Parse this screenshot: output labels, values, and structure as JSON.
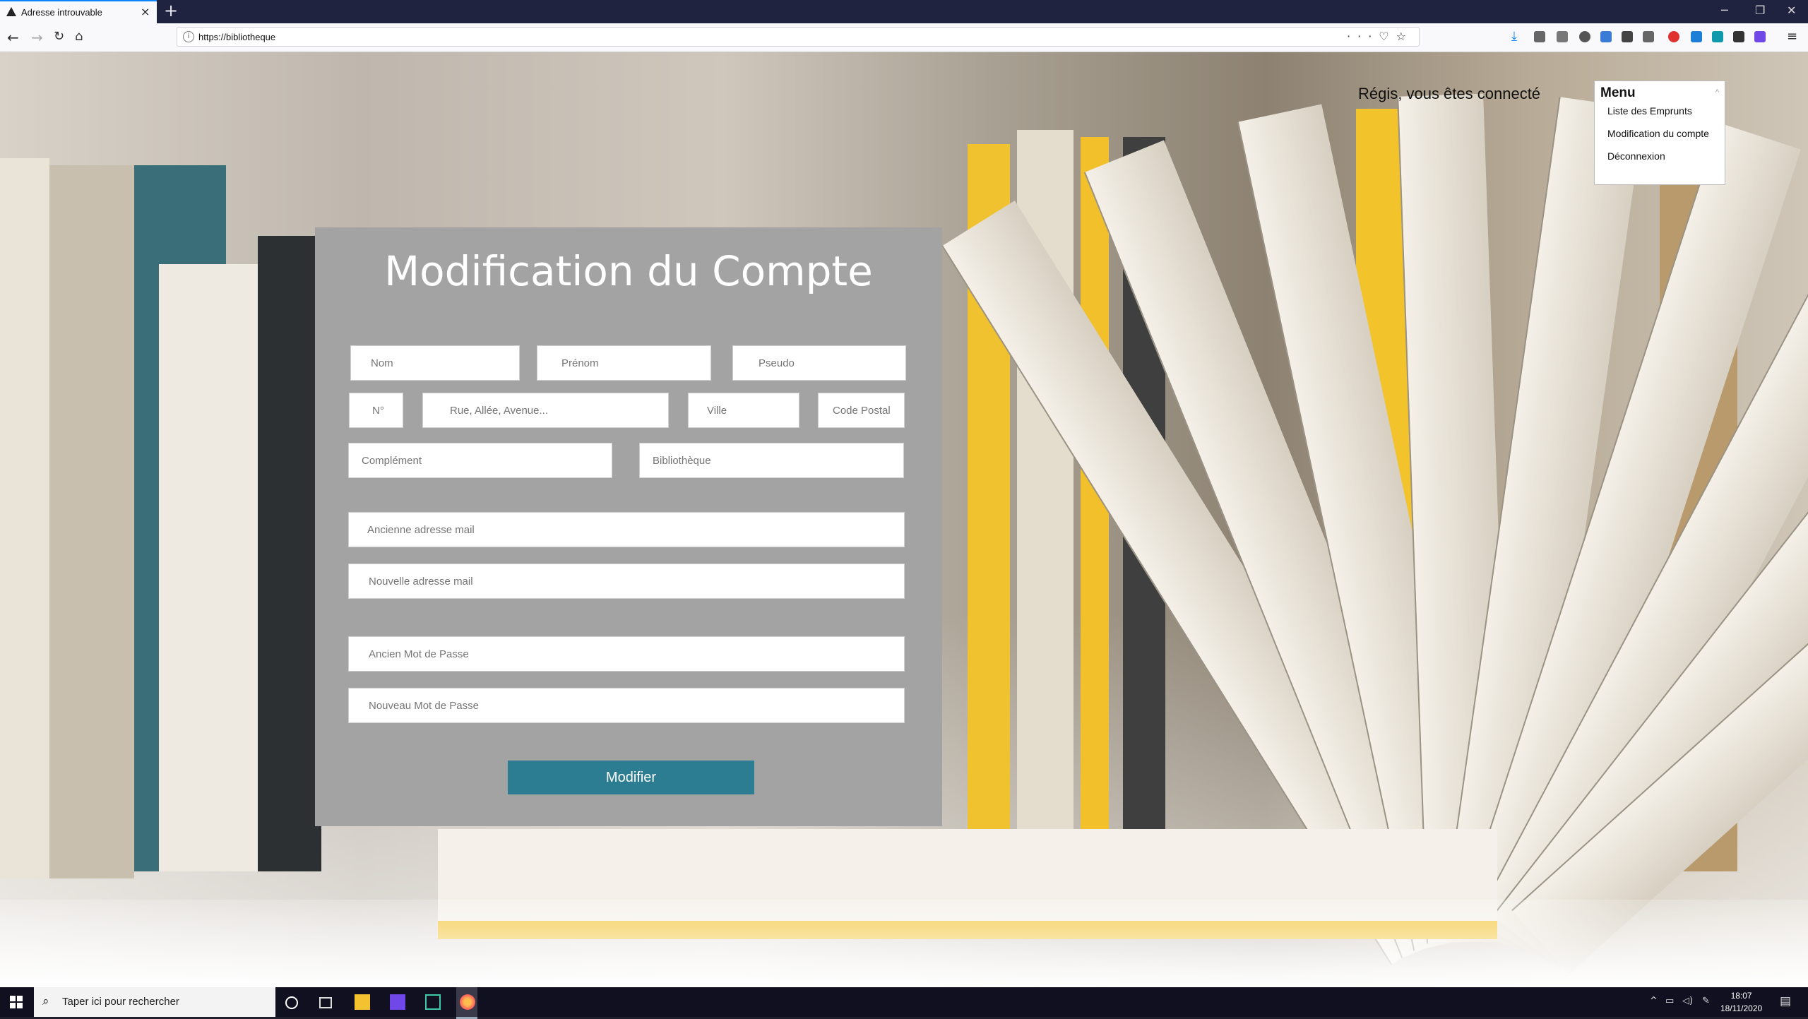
{
  "browser": {
    "tab_title": "Adresse introuvable",
    "url": "https://bibliotheque",
    "new_tab": "+",
    "close_tab": "×",
    "window_controls": [
      "─",
      "❐",
      "✕"
    ]
  },
  "header": {
    "welcome": "Régis, vous êtes connecté"
  },
  "menu": {
    "title": "Menu",
    "items": [
      {
        "label": "Liste des Emprunts"
      },
      {
        "label": "Modification du compte"
      },
      {
        "label": "Déconnexion"
      }
    ]
  },
  "form": {
    "title": "Modification du Compte",
    "placeholders": {
      "nom": "Nom",
      "prenom": "Prénom",
      "pseudo": "Pseudo",
      "numero": "N°",
      "rue": "Rue, Allée, Avenue...",
      "ville": "Ville",
      "code_postal": "Code Postal",
      "complement": "Complément",
      "bibliotheque": "Bibliothèque",
      "ancien_mail": "Ancienne adresse mail",
      "nouveau_mail": "Nouvelle adresse mail",
      "ancien_mdp": "Ancien Mot de Passe",
      "nouveau_mdp": "Nouveau Mot de Passe"
    },
    "submit": "Modifier"
  },
  "taskbar": {
    "search_placeholder": "Taper ici pour rechercher",
    "time": "18:07",
    "date": "18/11/2020"
  },
  "colors": {
    "button": "#2c7d92",
    "panel": "#a3a3a3",
    "taskbar": "#101020",
    "tabbar": "#202340"
  }
}
